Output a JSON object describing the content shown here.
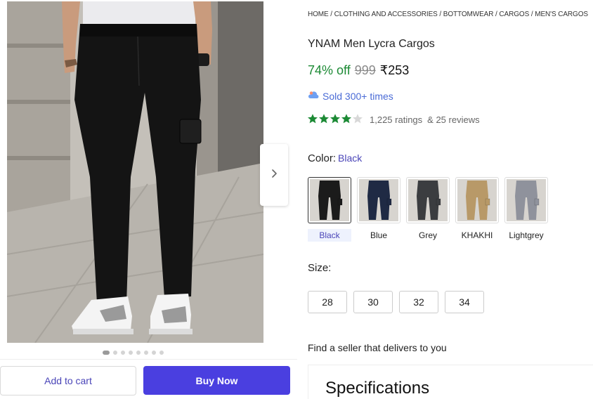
{
  "breadcrumb": [
    {
      "label": "HOME"
    },
    {
      "label": "CLOTHING AND ACCESSORIES"
    },
    {
      "label": "BOTTOMWEAR"
    },
    {
      "label": "CARGOS"
    },
    {
      "label": "MEN'S CARGOS"
    }
  ],
  "breadcrumb_separator": " / ",
  "product": {
    "title": "YNAM Men Lycra Cargos",
    "discount": "74% off",
    "mrp": "999",
    "price": "₹253",
    "sold_text": "Sold 300+ times",
    "rating_value": 4,
    "rating_max": 5,
    "ratings_text": "1,225 ratings",
    "reviews_text": "& 25 reviews"
  },
  "gallery": {
    "image_count": 8,
    "active_index": 0
  },
  "color": {
    "label": "Color:",
    "selected": "Black",
    "options": [
      {
        "name": "Black",
        "swatch": "#1b1b1b"
      },
      {
        "name": "Blue",
        "swatch": "#1f2a44"
      },
      {
        "name": "Grey",
        "swatch": "#3b3d40"
      },
      {
        "name": "KHAKHI",
        "swatch": "#b89968"
      },
      {
        "name": "Lightgrey",
        "swatch": "#8f929c"
      }
    ]
  },
  "size": {
    "label": "Size:",
    "options": [
      "28",
      "30",
      "32",
      "34"
    ]
  },
  "actions": {
    "add_to_cart": "Add to cart",
    "buy_now": "Buy Now"
  },
  "seller_text": "Find a seller that delivers to you",
  "specifications_title": "Specifications",
  "colors": {
    "accent": "#4a3fe0",
    "link": "#4a45b8",
    "discount_green": "#1c8a35",
    "star_green": "#1c8a35",
    "sold_blue": "#4a6bd6"
  },
  "icons": {
    "next": "chevron-right-icon",
    "sold": "cloud-badge-icon",
    "star": "star-icon"
  }
}
